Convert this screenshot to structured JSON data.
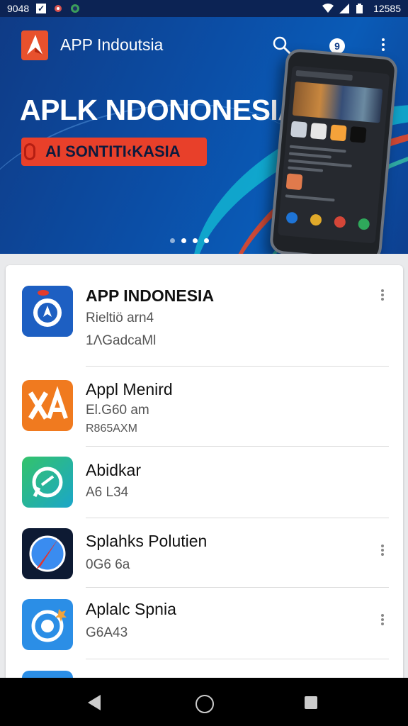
{
  "status_bar": {
    "time_left": "9048",
    "time_right": "12585",
    "icons": [
      "check-icon",
      "notification-icon",
      "notification-icon",
      "wifi-icon",
      "signal-icon",
      "battery-icon"
    ]
  },
  "header": {
    "app_title": "APP Indoutsia",
    "icons": [
      "app-logo-icon",
      "search-icon",
      "account-icon",
      "more-vert-icon"
    ],
    "avatar_glyph": "9"
  },
  "hero": {
    "headline": "APLK NDONONESIA",
    "promo_text": "AI SONTITI‹KASIA",
    "carousel_dots": 4,
    "active_dot": 1,
    "colors": {
      "background": "#0b4ea6",
      "promo": "#e8402a",
      "accent": "#12c0d6"
    }
  },
  "apps": [
    {
      "name": "APP INDONESIA",
      "line1": "Rieltiö arn4",
      "line2": "1ΛGadcaMl",
      "has_menu": true,
      "icon": "compass-icon"
    },
    {
      "name": "Appl Menird",
      "line1": "El.G60 am",
      "line2": "R865AXM",
      "has_menu": false,
      "icon": "editor-icon"
    },
    {
      "name": "Abidkar",
      "line1": "A6 L34",
      "line2": "",
      "has_menu": false,
      "icon": "chat-icon"
    },
    {
      "name": "Splahks Polutien",
      "line1": "0G6 6a",
      "line2": "",
      "has_menu": true,
      "icon": "browser-icon"
    },
    {
      "name": "Aplalc Spnia",
      "line1": "G6A43",
      "line2": "",
      "has_menu": true,
      "icon": "camera-icon"
    },
    {
      "name": "",
      "line1": "",
      "line2": "",
      "has_menu": false,
      "icon": "app-icon"
    }
  ],
  "nav_bar": {
    "icons": [
      "back-icon",
      "home-icon",
      "recents-icon"
    ]
  }
}
